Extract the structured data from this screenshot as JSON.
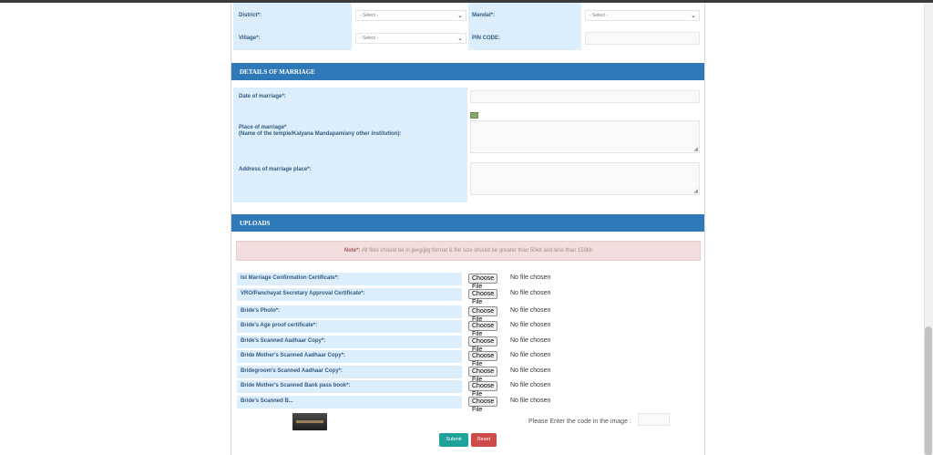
{
  "location": {
    "district_label": "District*:",
    "district_value": "- Select -",
    "mandal_label": "Mandal*:",
    "mandal_value": "- Select -",
    "village_label": "Village*:",
    "village_value": "- Select -",
    "pincode_label": "PIN CODE:"
  },
  "marriage": {
    "section_title": "DETAILS OF MARRIAGE",
    "date_label": "Date of marriage*:",
    "place_label_line1": "Place of marriage*",
    "place_label_line2": "(Name of the temple/Kalyana Mandapam/any other institution):",
    "address_label": "Address of marriage place*:"
  },
  "uploads": {
    "section_title": "UPLOADS",
    "note_prefix": "Note*:",
    "note_text": "All files should be in jpeg/jpg format & file size should be greater than 50kb and less than 150kb",
    "choose_label": "Choose File",
    "no_file_label": "No file chosen",
    "items": [
      "Ist Marriage Confirmation Certificate*:",
      "VRO/Panchayat Secretary Approval Certificate*:",
      "Bride's Photo*:",
      "Bride's Age proof certificate*:",
      "Bride's Scanned Aadhaar Copy*:",
      "Bride Mother's Scanned Aadhaar Copy*:",
      "Bridegroom's Scanned Aadhaar Copy*:",
      "Bride Mother's Scanned Bank pass book*:",
      "Bride's Scanned B..."
    ]
  },
  "captcha": {
    "label": "Please Enter the code in the image :"
  },
  "actions": {
    "submit_label": "Submit",
    "reset_label": "Reset",
    "submit_color": "#1ea39a",
    "reset_color": "#cf4b47"
  },
  "colors": {
    "section_header": "#2f79b8",
    "label_bg": "#dcedfb",
    "label_text": "#335a80",
    "note_bg": "#f2dede"
  }
}
